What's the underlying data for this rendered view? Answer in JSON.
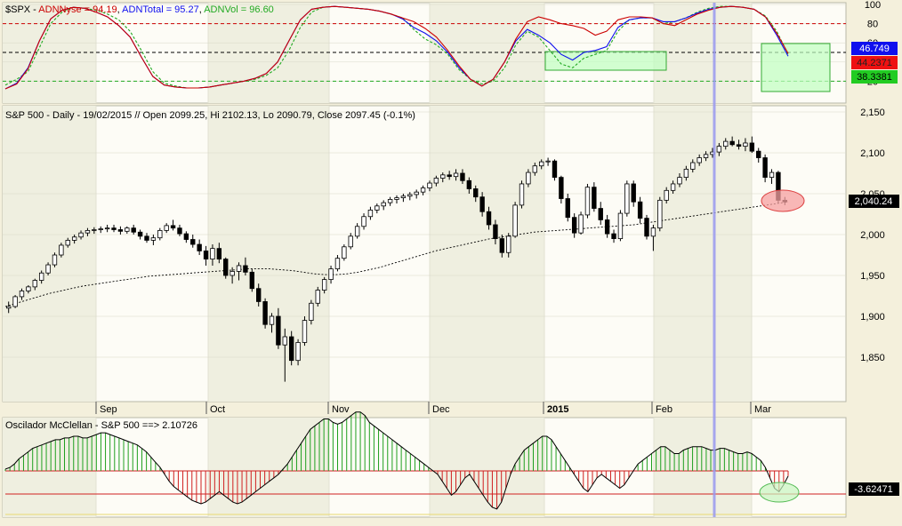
{
  "colors": {
    "frame_bg": "#f4f0dc",
    "pane_bg": "#fdfcf6",
    "band_bg": "#efefe0",
    "grid": "#d8d8c8",
    "red": "#cc0000",
    "blue": "#1010ee",
    "green_dash": "#22aa22",
    "black": "#000000",
    "up_fill": "#ffffff",
    "down_fill": "#000000",
    "hist_up": "#20a020",
    "hist_down": "#d02020",
    "vertical_marker": "#9999ee",
    "zero_line": "#d02020",
    "green_box": "#bfffc0",
    "pink_oval": "#f6a0a0"
  },
  "breadth_panel": {
    "header": {
      "prefix": "$SPX - ",
      "s1": "ADNNyse = 94.19",
      "sep1": ", ",
      "s2": "ADNTotal = 95.27",
      "sep2": ", ",
      "s3": "ADNVol = 96.60"
    },
    "y_ticks": [
      "100",
      "80",
      "60",
      "40",
      "20"
    ],
    "badges": {
      "blue": "46.749",
      "red": "44.2371",
      "green": "38.3381"
    },
    "ref_levels": {
      "upper": 80,
      "middle": 50,
      "lower": 20
    }
  },
  "price_panel": {
    "header": "S&P 500 - Daily - 19/02/2015 // Open 2099.25, Hi 2102.13, Lo 2090.79, Close 2097.45 (-0.1%)",
    "y_ticks": [
      "2,150",
      "2,100",
      "2,050",
      "2,000",
      "1,950",
      "1,900",
      "1,850"
    ],
    "badge": "2,040.24",
    "x_labels": [
      "Sep",
      "Oct",
      "Nov",
      "Dec",
      "2015",
      "Feb",
      "Mar"
    ]
  },
  "oscillator_panel": {
    "header": "Oscilador McClellan - S&P 500 ==> 2.10726",
    "badge": "-3.62471"
  },
  "chart_data": [
    {
      "type": "line",
      "series": [
        {
          "name": "ADNNyse",
          "color": "#cc0000",
          "y": [
            12,
            17,
            33,
            62,
            85,
            94,
            97,
            96,
            92,
            87,
            78,
            66,
            45,
            25,
            16,
            14,
            13,
            13,
            14,
            16,
            18,
            20,
            23,
            28,
            40,
            62,
            84,
            95,
            97,
            98,
            97,
            96,
            95,
            93,
            90,
            86,
            82,
            75,
            66,
            52,
            36,
            22,
            15,
            22,
            40,
            64,
            82,
            87,
            84,
            80,
            78,
            75,
            68,
            72,
            84,
            87,
            87,
            86,
            80,
            78,
            84,
            90,
            94,
            97,
            98,
            97,
            95,
            87,
            70,
            49
          ]
        },
        {
          "name": "ADNTotal",
          "color": "#1010ee",
          "y": [
            12,
            18,
            34,
            62,
            85,
            94,
            97,
            96,
            92,
            87,
            78,
            66,
            45,
            25,
            16,
            14,
            13,
            13,
            14,
            16,
            18,
            20,
            23,
            28,
            40,
            62,
            84,
            95,
            97,
            98,
            97,
            96,
            95,
            93,
            90,
            85,
            76,
            70,
            62,
            50,
            34,
            22,
            15,
            22,
            40,
            62,
            74,
            68,
            60,
            48,
            42,
            50,
            52,
            56,
            76,
            84,
            86,
            86,
            82,
            82,
            86,
            91,
            95,
            97,
            98,
            97,
            95,
            87,
            68,
            46
          ]
        },
        {
          "name": "ADNVol",
          "color": "#22aa22",
          "y": [
            16,
            22,
            30,
            55,
            80,
            92,
            97,
            96,
            94,
            90,
            84,
            72,
            52,
            30,
            18,
            15,
            13,
            13,
            14,
            16,
            18,
            20,
            22,
            26,
            34,
            52,
            76,
            92,
            97,
            98,
            97,
            96,
            95,
            93,
            90,
            86,
            74,
            64,
            58,
            48,
            32,
            22,
            17,
            20,
            34,
            58,
            72,
            66,
            52,
            38,
            34,
            44,
            48,
            52,
            72,
            84,
            86,
            86,
            80,
            82,
            86,
            92,
            96,
            98,
            98,
            97,
            95,
            88,
            72,
            48
          ]
        }
      ]
    },
    {
      "type": "candlestick",
      "ohlc": [
        [
          1910,
          1918,
          1904,
          1912
        ],
        [
          1912,
          1926,
          1910,
          1924
        ],
        [
          1924,
          1934,
          1920,
          1931
        ],
        [
          1931,
          1938,
          1928,
          1936
        ],
        [
          1936,
          1946,
          1932,
          1944
        ],
        [
          1944,
          1956,
          1940,
          1953
        ],
        [
          1953,
          1966,
          1950,
          1963
        ],
        [
          1963,
          1978,
          1960,
          1975
        ],
        [
          1975,
          1990,
          1972,
          1987
        ],
        [
          1987,
          1996,
          1984,
          1993
        ],
        [
          1993,
          2000,
          1989,
          1997
        ],
        [
          1997,
          2005,
          1994,
          2002
        ],
        [
          2002,
          2008,
          1998,
          2005
        ],
        [
          2005,
          2009,
          2001,
          2006
        ],
        [
          2006,
          2010,
          2002,
          2007
        ],
        [
          2007,
          2012,
          2003,
          2008
        ],
        [
          2008,
          2012,
          2003,
          2006
        ],
        [
          2006,
          2010,
          2000,
          2004
        ],
        [
          2004,
          2010,
          2001,
          2008
        ],
        [
          2008,
          2012,
          2000,
          2003
        ],
        [
          2003,
          2006,
          1994,
          1998
        ],
        [
          1998,
          2002,
          1990,
          1993
        ],
        [
          1993,
          2000,
          1987,
          1996
        ],
        [
          1996,
          2008,
          1993,
          2005
        ],
        [
          2005,
          2014,
          2002,
          2011
        ],
        [
          2011,
          2018,
          2005,
          2008
        ],
        [
          2008,
          2012,
          1998,
          2001
        ],
        [
          2001,
          2004,
          1990,
          1994
        ],
        [
          1994,
          2000,
          1984,
          1988
        ],
        [
          1988,
          1994,
          1975,
          1980
        ],
        [
          1980,
          1986,
          1962,
          1970
        ],
        [
          1970,
          1988,
          1962,
          1983
        ],
        [
          1983,
          1990,
          1965,
          1970
        ],
        [
          1970,
          1972,
          1946,
          1950
        ],
        [
          1950,
          1960,
          1940,
          1955
        ],
        [
          1955,
          1966,
          1944,
          1962
        ],
        [
          1962,
          1972,
          1950,
          1954
        ],
        [
          1954,
          1958,
          1930,
          1934
        ],
        [
          1934,
          1940,
          1912,
          1918
        ],
        [
          1918,
          1922,
          1885,
          1890
        ],
        [
          1890,
          1904,
          1880,
          1900
        ],
        [
          1900,
          1910,
          1860,
          1865
        ],
        [
          1865,
          1885,
          1820,
          1875
        ],
        [
          1875,
          1882,
          1840,
          1846
        ],
        [
          1846,
          1872,
          1840,
          1868
        ],
        [
          1868,
          1900,
          1864,
          1895
        ],
        [
          1895,
          1920,
          1890,
          1916
        ],
        [
          1916,
          1936,
          1912,
          1932
        ],
        [
          1932,
          1948,
          1928,
          1945
        ],
        [
          1945,
          1962,
          1940,
          1958
        ],
        [
          1958,
          1975,
          1955,
          1971
        ],
        [
          1971,
          1988,
          1968,
          1985
        ],
        [
          1985,
          2002,
          1982,
          1998
        ],
        [
          1998,
          2014,
          1995,
          2010
        ],
        [
          2010,
          2026,
          2006,
          2022
        ],
        [
          2022,
          2034,
          2018,
          2030
        ],
        [
          2030,
          2038,
          2026,
          2035
        ],
        [
          2035,
          2042,
          2030,
          2039
        ],
        [
          2039,
          2046,
          2035,
          2043
        ],
        [
          2043,
          2048,
          2038,
          2045
        ],
        [
          2045,
          2050,
          2040,
          2047
        ],
        [
          2047,
          2052,
          2042,
          2049
        ],
        [
          2049,
          2055,
          2044,
          2052
        ],
        [
          2052,
          2060,
          2048,
          2057
        ],
        [
          2057,
          2066,
          2053,
          2063
        ],
        [
          2063,
          2072,
          2059,
          2069
        ],
        [
          2069,
          2076,
          2064,
          2073
        ],
        [
          2073,
          2078,
          2067,
          2071
        ],
        [
          2071,
          2080,
          2066,
          2075
        ],
        [
          2075,
          2080,
          2062,
          2066
        ],
        [
          2066,
          2070,
          2050,
          2056
        ],
        [
          2056,
          2060,
          2040,
          2046
        ],
        [
          2046,
          2052,
          2022,
          2028
        ],
        [
          2028,
          2034,
          2006,
          2012
        ],
        [
          2012,
          2018,
          1988,
          1995
        ],
        [
          1995,
          2000,
          1972,
          1978
        ],
        [
          1978,
          2002,
          1972,
          1998
        ],
        [
          1998,
          2040,
          1996,
          2036
        ],
        [
          2036,
          2066,
          2032,
          2062
        ],
        [
          2062,
          2080,
          2058,
          2076
        ],
        [
          2076,
          2088,
          2072,
          2084
        ],
        [
          2084,
          2092,
          2080,
          2089
        ],
        [
          2089,
          2094,
          2084,
          2090
        ],
        [
          2090,
          2092,
          2066,
          2070
        ],
        [
          2070,
          2072,
          2038,
          2044
        ],
        [
          2044,
          2050,
          2016,
          2021
        ],
        [
          2021,
          2026,
          1996,
          2002
        ],
        [
          2002,
          2028,
          2000,
          2024
        ],
        [
          2024,
          2062,
          2020,
          2058
        ],
        [
          2058,
          2064,
          2028,
          2032
        ],
        [
          2032,
          2040,
          2012,
          2018
        ],
        [
          2018,
          2024,
          1996,
          2001
        ],
        [
          2001,
          2006,
          1990,
          1995
        ],
        [
          1995,
          2030,
          1992,
          2026
        ],
        [
          2026,
          2066,
          2022,
          2062
        ],
        [
          2062,
          2066,
          2034,
          2040
        ],
        [
          2040,
          2046,
          2014,
          2020
        ],
        [
          2020,
          2024,
          1994,
          1998
        ],
        [
          1998,
          2012,
          1980,
          2008
        ],
        [
          2008,
          2046,
          2004,
          2042
        ],
        [
          2042,
          2058,
          2038,
          2054
        ],
        [
          2054,
          2066,
          2050,
          2062
        ],
        [
          2062,
          2075,
          2058,
          2070
        ],
        [
          2070,
          2084,
          2066,
          2080
        ],
        [
          2080,
          2092,
          2076,
          2088
        ],
        [
          2088,
          2098,
          2084,
          2094
        ],
        [
          2094,
          2102,
          2090,
          2098
        ],
        [
          2098,
          2106,
          2094,
          2101
        ],
        [
          2101,
          2112,
          2096,
          2108
        ],
        [
          2108,
          2118,
          2104,
          2114
        ],
        [
          2114,
          2120,
          2108,
          2110
        ],
        [
          2110,
          2116,
          2104,
          2108
        ],
        [
          2108,
          2118,
          2102,
          2112
        ],
        [
          2112,
          2120,
          2100,
          2102
        ],
        [
          2102,
          2106,
          2088,
          2094
        ],
        [
          2094,
          2098,
          2064,
          2070
        ],
        [
          2070,
          2080,
          2062,
          2076
        ],
        [
          2076,
          2078,
          2038,
          2042
        ],
        [
          2042,
          2046,
          2036,
          2040
        ]
      ],
      "ma": [
        1912,
        1916,
        1920,
        1924,
        1928,
        1931,
        1934,
        1937,
        1939,
        1941,
        1943,
        1945,
        1947,
        1949,
        1950,
        1951,
        1952,
        1953,
        1954,
        1955,
        1956,
        1957,
        1958,
        1958,
        1958,
        1957,
        1956,
        1954,
        1952,
        1951,
        1951,
        1952,
        1954,
        1957,
        1960,
        1964,
        1968,
        1972,
        1976,
        1980,
        1983,
        1986,
        1989,
        1992,
        1995,
        1997,
        1999,
        2001,
        2003,
        2004,
        2005,
        2006,
        2007,
        2008,
        2009,
        2010,
        2011,
        2012,
        2014,
        2016,
        2018,
        2020,
        2022,
        2024,
        2026,
        2028,
        2030,
        2032,
        2034,
        2036,
        2038,
        2040
      ]
    },
    {
      "type": "bar",
      "values": [
        1,
        2,
        4,
        7,
        9,
        11,
        13,
        14,
        15,
        16,
        17,
        18,
        18,
        19,
        19,
        20,
        20,
        19,
        19,
        20,
        21,
        22,
        22,
        21,
        20,
        19,
        18,
        17,
        16,
        15,
        13,
        11,
        8,
        5,
        2,
        -2,
        -6,
        -9,
        -11,
        -13,
        -15,
        -17,
        -18,
        -19,
        -18,
        -16,
        -14,
        -12,
        -14,
        -16,
        -18,
        -19,
        -18,
        -16,
        -14,
        -12,
        -10,
        -8,
        -6,
        -4,
        -2,
        1,
        4,
        8,
        12,
        16,
        20,
        24,
        26,
        28,
        30,
        30,
        28,
        27,
        28,
        30,
        32,
        34,
        34,
        32,
        28,
        26,
        24,
        22,
        20,
        18,
        16,
        14,
        12,
        10,
        8,
        6,
        4,
        2,
        0,
        -2,
        -6,
        -10,
        -14,
        -12,
        -8,
        -4,
        -2,
        -6,
        -10,
        -14,
        -18,
        -21,
        -22,
        -18,
        -10,
        -2,
        4,
        8,
        12,
        14,
        16,
        18,
        20,
        20,
        18,
        14,
        10,
        6,
        2,
        -2,
        -6,
        -10,
        -12,
        -8,
        -4,
        -2,
        -4,
        -6,
        -8,
        -10,
        -8,
        -4,
        0,
        4,
        6,
        8,
        10,
        12,
        14,
        14,
        12,
        10,
        10,
        12,
        13,
        14,
        14,
        14,
        13,
        12,
        12,
        13,
        13,
        12,
        11,
        10,
        10,
        11,
        10,
        8,
        6,
        2,
        -4,
        -10,
        -12,
        -8,
        -3
      ]
    }
  ]
}
